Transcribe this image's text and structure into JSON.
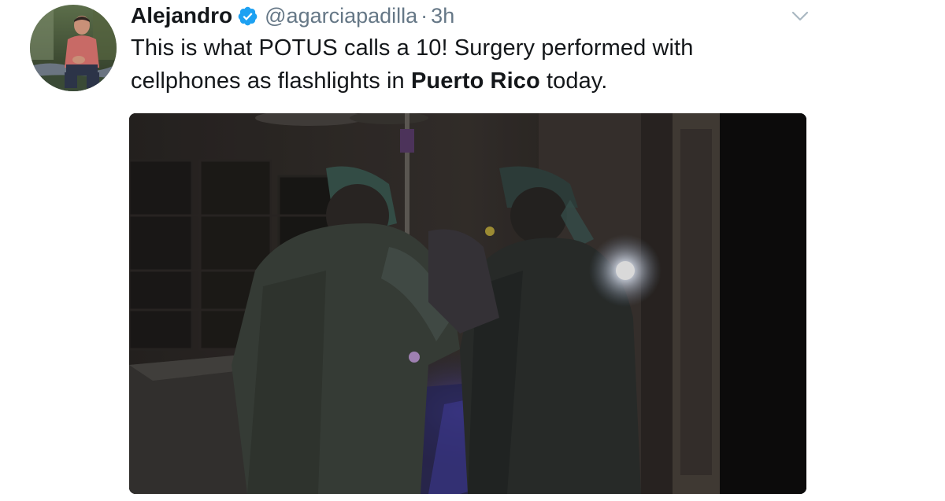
{
  "tweet": {
    "author": {
      "display_name": "Alejandro",
      "handle": "@agarciapadilla",
      "verified": true,
      "avatar_icon": "profile-photo"
    },
    "separator": "·",
    "timestamp": "3h",
    "text": {
      "part1": "This is what POTUS calls a 10! Surgery performed with cellphones as flashlights in ",
      "bold": "Puerto Rico",
      "part2": " today."
    },
    "menu_icon": "chevron-down-icon",
    "media": {
      "type": "photo"
    }
  },
  "colors": {
    "text": "#14171a",
    "muted": "#657786",
    "verified_blue": "#1da1f2"
  }
}
